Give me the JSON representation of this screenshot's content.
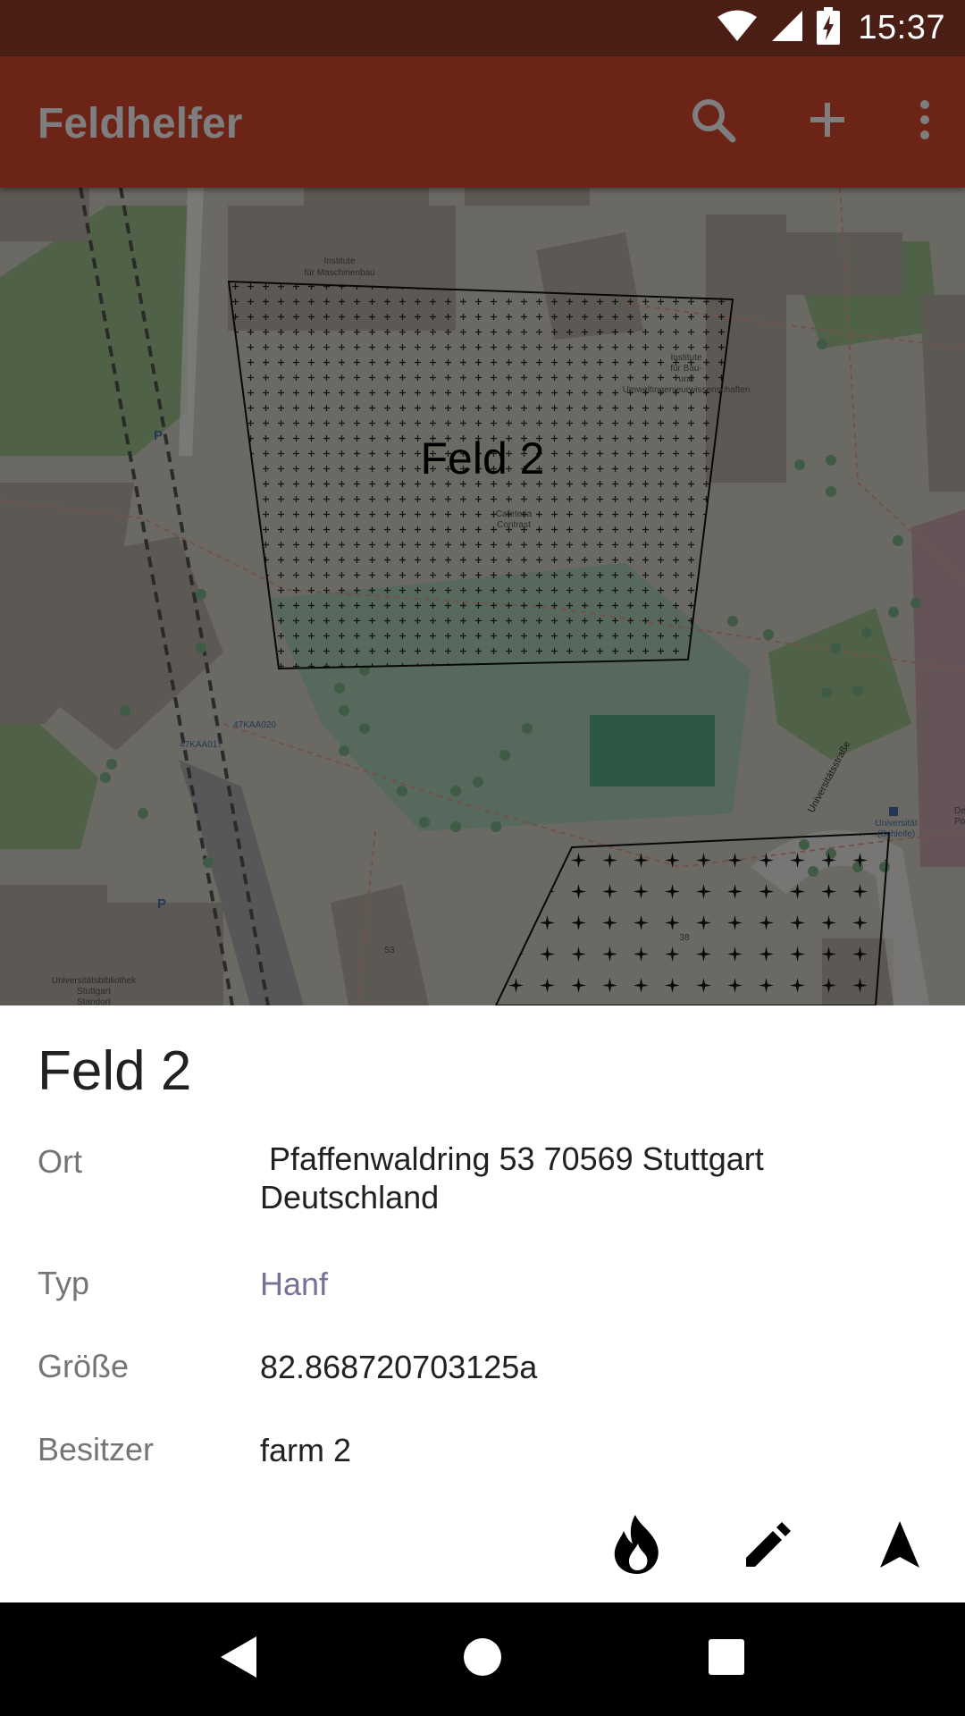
{
  "status_bar": {
    "time": "15:37",
    "icons": [
      "wifi-icon",
      "signal-icon",
      "battery-charging-icon"
    ]
  },
  "app_bar": {
    "title": "Feldhelfer",
    "actions": [
      "search-icon",
      "add-icon",
      "more-vert-icon"
    ]
  },
  "map": {
    "field_label": "Feld 2",
    "street_label": "Universitätsstraße",
    "poi_labels": {
      "institute_machine": [
        "Institute",
        "für Maschinenbau"
      ],
      "institute_bau": [
        "Institute",
        "für Bau-",
        "und",
        "Umweltingenieurwissenschaften"
      ],
      "cafeteria": [
        "Cafeteria",
        "Contrast"
      ],
      "bus_stop_1": "47KAA017",
      "bus_stop_2": "47KAA020",
      "library": [
        "Universitätsbibliothek",
        "Stuttgart",
        "Standort"
      ],
      "university_stop": [
        "Universität",
        "(Schleife)"
      ],
      "number_53": "53",
      "number_38": "38",
      "edge_label": [
        "De",
        "Po"
      ]
    }
  },
  "details": {
    "title": "Feld 2",
    "rows": [
      {
        "label": "Ort",
        "value": " Pfaffenwaldring 53 70569 Stuttgart Deutschland"
      },
      {
        "label": "Typ",
        "value": "Hanf"
      },
      {
        "label": "Größe",
        "value": "82.868720703125a"
      },
      {
        "label": "Besitzer",
        "value": "farm 2"
      }
    ],
    "actions": [
      "fire-icon",
      "edit-icon",
      "navigation-icon"
    ]
  },
  "nav_bar": {
    "buttons": [
      "back-icon",
      "home-icon",
      "recents-icon"
    ]
  },
  "colors": {
    "status_bar": "#4a1e15",
    "app_bar": "#6c2417",
    "link": "#7a6f99"
  }
}
